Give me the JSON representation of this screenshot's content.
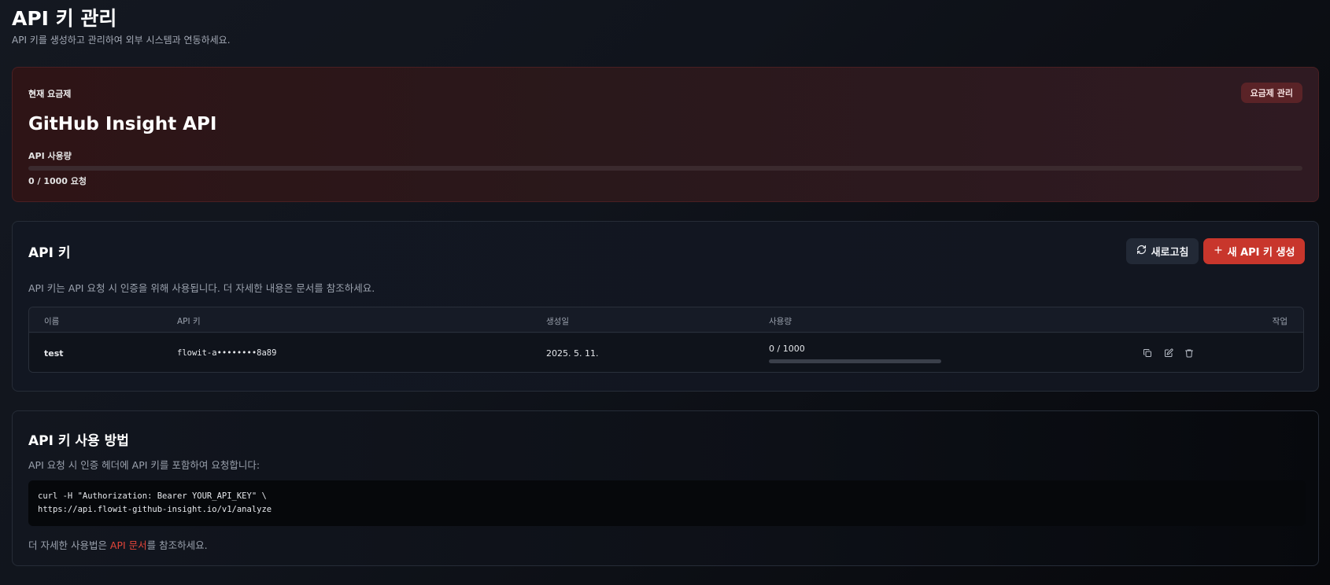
{
  "header": {
    "title": "API 키 관리",
    "subtitle": "API 키를 생성하고 관리하여 외부 시스템과 연동하세요."
  },
  "plan": {
    "label": "현재 요금제",
    "manage_button": "요금제 관리",
    "name": "GitHub Insight API",
    "usage_label": "API 사용량",
    "usage_text": "0 / 1000 요청",
    "usage_fraction": 0,
    "accent_color": "#d6453d"
  },
  "keys": {
    "title": "API 키",
    "refresh_button": "새로고침",
    "new_key_button": "새 API 키 생성",
    "description": "API 키는 API 요청 시 인증을 위해 사용됩니다. 더 자세한 내용은 문서를 참조하세요.",
    "columns": [
      "이름",
      "API 키",
      "생성일",
      "사용량",
      "작업"
    ],
    "rows": [
      {
        "name": "test",
        "key": "flowit-a••••••••8a89",
        "created": "2025. 5. 11.",
        "usage_text": "0 / 1000",
        "usage_fraction": 0,
        "actions": [
          "copy-icon",
          "edit-icon",
          "trash-icon"
        ]
      }
    ]
  },
  "guide": {
    "title": "API 키 사용 방법",
    "description": "API 요청 시 인증 헤더에 API 키를 포함하여 요청합니다:",
    "code": "curl -H \"Authorization: Bearer YOUR_API_KEY\" \\\nhttps://api.flowit-github-insight.io/v1/analyze",
    "footer_before": "더 자세한 사용법은 ",
    "footer_link": "API 문서",
    "footer_after": "를 참조하세요."
  }
}
